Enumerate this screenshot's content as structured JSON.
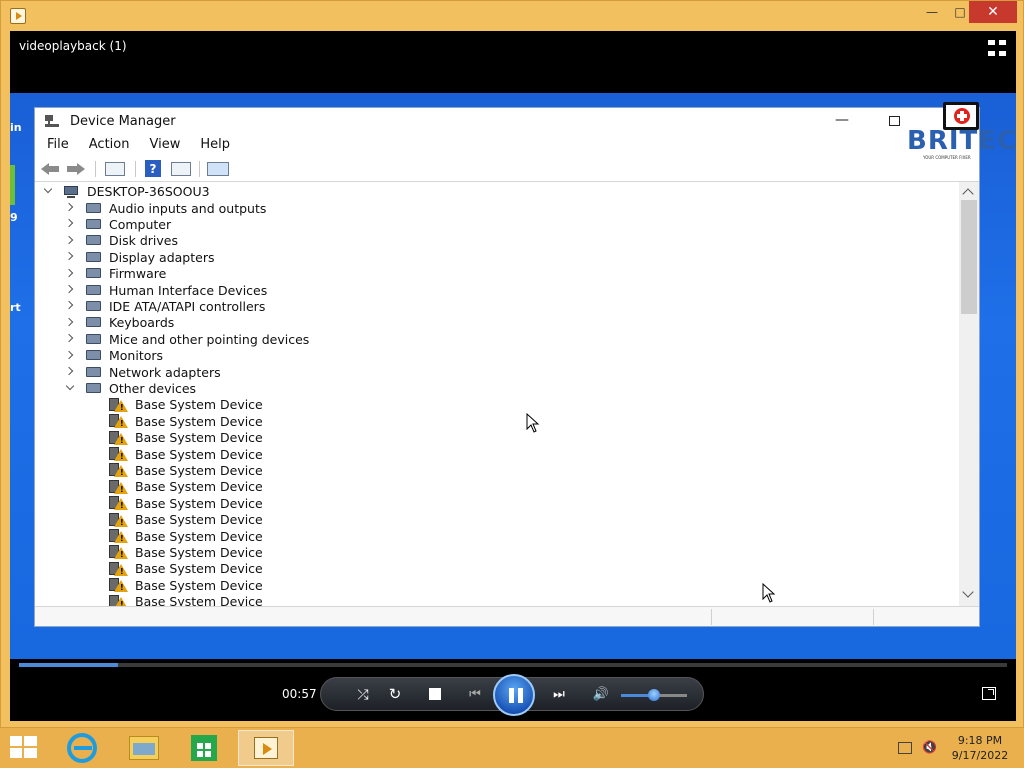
{
  "player": {
    "title": "videoplayback (1)",
    "window_controls": {
      "minimize": "—",
      "maximize": "□",
      "close": "✕"
    },
    "time": "00:57",
    "progress_fraction": 0.1,
    "volume_fraction": 0.5
  },
  "desktop_partial_labels": [
    "in",
    "9",
    "rt"
  ],
  "device_manager": {
    "title": "Device Manager",
    "menu": [
      "File",
      "Action",
      "View",
      "Help"
    ],
    "help_icon_glyph": "?",
    "tree": {
      "root": "DESKTOP-36SOOU3",
      "categories": [
        {
          "label": "Audio inputs and outputs",
          "icon": "speaker-icon",
          "expanded": false
        },
        {
          "label": "Computer",
          "icon": "computer-icon",
          "expanded": false
        },
        {
          "label": "Disk drives",
          "icon": "disk-icon",
          "expanded": false
        },
        {
          "label": "Display adapters",
          "icon": "display-adapter-icon",
          "expanded": false
        },
        {
          "label": "Firmware",
          "icon": "chip-icon",
          "expanded": false
        },
        {
          "label": "Human Interface Devices",
          "icon": "hid-icon",
          "expanded": false
        },
        {
          "label": "IDE ATA/ATAPI controllers",
          "icon": "ide-icon",
          "expanded": false
        },
        {
          "label": "Keyboards",
          "icon": "keyboard-icon",
          "expanded": false
        },
        {
          "label": "Mice and other pointing devices",
          "icon": "mouse-icon",
          "expanded": false
        },
        {
          "label": "Monitors",
          "icon": "monitor-icon",
          "expanded": false
        },
        {
          "label": "Network adapters",
          "icon": "network-icon",
          "expanded": false
        },
        {
          "label": "Other devices",
          "icon": "unknown-device-icon",
          "expanded": true
        }
      ],
      "other_devices": [
        "Base System Device",
        "Base System Device",
        "Base System Device",
        "Base System Device",
        "Base System Device",
        "Base System Device",
        "Base System Device",
        "Base System Device",
        "Base System Device",
        "Base System Device",
        "Base System Device",
        "Base System Device",
        "Base System Device"
      ]
    }
  },
  "watermark": {
    "brand": "BRITEC",
    "tagline": "YOUR COMPUTER FIXER"
  },
  "taskbar": {
    "apps": [
      {
        "name": "internet-explorer",
        "active": false
      },
      {
        "name": "file-explorer",
        "active": false
      },
      {
        "name": "store",
        "active": false
      },
      {
        "name": "media-player",
        "active": true
      }
    ],
    "clock_time": "9:18 PM",
    "clock_date": "9/17/2022"
  },
  "colors": {
    "accent": "#4a8ad8",
    "taskbar": "#e9b04d",
    "desktop_blue": "#1e6fe8",
    "warning": "#e3a20f",
    "britec_blue": "#2b5fb0"
  }
}
